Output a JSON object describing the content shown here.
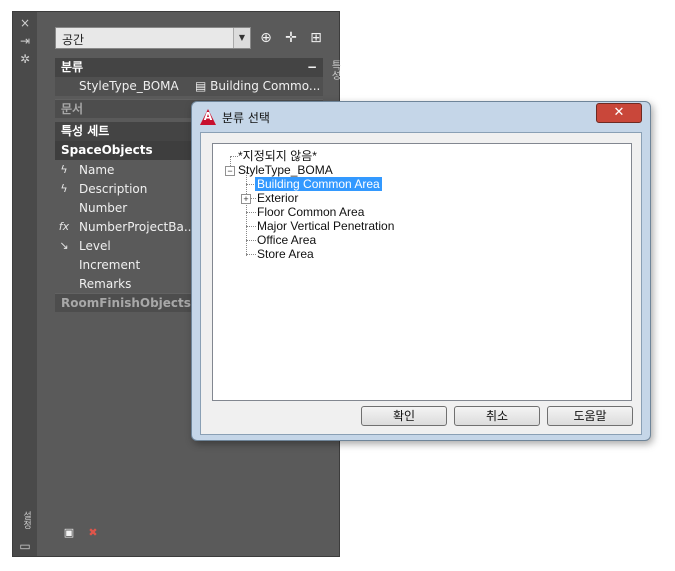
{
  "palette": {
    "strip_icons": [
      "×",
      "⇥",
      "✲"
    ],
    "vertical_label": "특성",
    "bottom_strip_icons": [
      "설정",
      "▭"
    ],
    "combo_value": "공간",
    "tool_icons": [
      "⊕",
      "✛",
      "⊞"
    ],
    "groups": {
      "classification": "분류",
      "document": "문서",
      "property_sets": "특성 세트",
      "space_objects": "SpaceObjects",
      "room_finish": "RoomFinishObjects"
    },
    "classification_row": {
      "name": "StyleType_BOMA",
      "value": "Building Commo..."
    },
    "properties": [
      {
        "icon": "ϟ",
        "name": "Name"
      },
      {
        "icon": "ϟ",
        "name": "Description"
      },
      {
        "icon": "",
        "name": "Number"
      },
      {
        "icon": "fx",
        "name": "NumberProjectBa..."
      },
      {
        "icon": "↘",
        "name": "Level"
      },
      {
        "icon": "",
        "name": "Increment"
      },
      {
        "icon": "",
        "name": "Remarks"
      }
    ],
    "bottom_icons": [
      "▣",
      "✖"
    ]
  },
  "dialog": {
    "title": "분류 선택",
    "close_label": "✕",
    "tree": {
      "unassigned": "*지정되지 않음*",
      "root": "StyleType_BOMA",
      "children": [
        "Building Common Area",
        "Exterior",
        "Floor Common Area",
        "Major Vertical Penetration",
        "Office Area",
        "Store Area"
      ],
      "selected": "Building Common Area"
    },
    "buttons": {
      "ok": "확인",
      "cancel": "취소",
      "help": "도움말"
    }
  }
}
